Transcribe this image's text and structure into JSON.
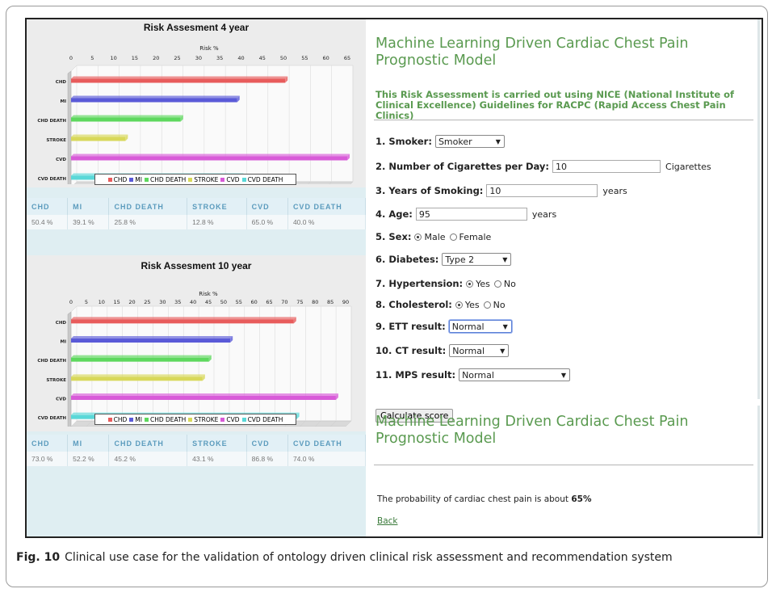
{
  "left_panel": {
    "charts": [
      {
        "title": "Risk Assesment 4 year",
        "axis_label": "Risk %",
        "ticks": [
          "0",
          "5",
          "10",
          "15",
          "20",
          "25",
          "30",
          "35",
          "40",
          "45",
          "50",
          "55",
          "60",
          "65"
        ],
        "axis_max": 65,
        "table_headers": [
          "CHD",
          "MI",
          "CHD DEATH",
          "STROKE",
          "CVD",
          "CVD DEATH"
        ],
        "table_values": [
          "50.4 %",
          "39.1 %",
          "25.8 %",
          "12.8 %",
          "65.0 %",
          "40.0 %"
        ]
      },
      {
        "title": "Risk Assesment 10 year",
        "axis_label": "Risk %",
        "ticks": [
          "0",
          "5",
          "10",
          "15",
          "20",
          "25",
          "30",
          "35",
          "40",
          "45",
          "50",
          "55",
          "60",
          "65",
          "70",
          "75",
          "80",
          "85",
          "90"
        ],
        "axis_max": 90,
        "table_headers": [
          "CHD",
          "MI",
          "CHD DEATH",
          "STROKE",
          "CVD",
          "CVD DEATH"
        ],
        "table_values": [
          "73.0 %",
          "52.2 %",
          "45.2 %",
          "43.1 %",
          "86.8 %",
          "74.0 %"
        ]
      }
    ]
  },
  "chart_data": [
    {
      "type": "bar",
      "title": "Risk Assesment 4 year",
      "xlabel": "Risk %",
      "ylabel": "",
      "categories": [
        "CHD",
        "MI",
        "CHD DEATH",
        "STROKE",
        "CVD",
        "CVD DEATH"
      ],
      "values": [
        50.4,
        39.1,
        25.8,
        12.8,
        65.0,
        40.0
      ],
      "xlim": [
        0,
        65
      ],
      "colors": [
        "#e85c5c",
        "#5a5ad8",
        "#5ed85e",
        "#d8d85a",
        "#d85ad8",
        "#5ad8d8"
      ],
      "legend": [
        "CHD",
        "MI",
        "CHD DEATH",
        "STROKE",
        "CVD",
        "CVD DEATH"
      ],
      "legend_position": "bottom",
      "grid": true
    },
    {
      "type": "bar",
      "title": "Risk Assesment 10 year",
      "xlabel": "Risk %",
      "ylabel": "",
      "categories": [
        "CHD",
        "MI",
        "CHD DEATH",
        "STROKE",
        "CVD",
        "CVD DEATH"
      ],
      "values": [
        73.0,
        52.2,
        45.2,
        43.1,
        86.8,
        74.0
      ],
      "xlim": [
        0,
        90
      ],
      "colors": [
        "#e85c5c",
        "#5a5ad8",
        "#5ed85e",
        "#d8d85a",
        "#d85ad8",
        "#5ad8d8"
      ],
      "legend": [
        "CHD",
        "MI",
        "CHD DEATH",
        "STROKE",
        "CVD",
        "CVD DEATH"
      ],
      "legend_position": "bottom",
      "grid": true
    }
  ],
  "form": {
    "title": "Machine Learning Driven Cardiac Chest Pain Prognostic Model",
    "subtitle": "This Risk Assessment is carried out using NICE (National Institute of Clinical Excellence) Guidelines for RACPC (Rapid Access Chest Pain Clinics)",
    "smoker_label": "1. Smoker:",
    "smoker_value": "Smoker",
    "cigs_label": "2. Number of Cigarettes per Day:",
    "cigs_value": "10",
    "cigs_unit": "Cigarettes",
    "years_label": "3. Years of Smoking:",
    "years_value": "10",
    "years_unit": "years",
    "age_label": "4. Age:",
    "age_value": "95",
    "age_unit": "years",
    "sex_label": "5. Sex:",
    "sex_male": "Male",
    "sex_female": "Female",
    "diabetes_label": "6. Diabetes:",
    "diabetes_value": "Type 2",
    "hyper_label": "7. Hypertension:",
    "yes": "Yes",
    "no": "No",
    "chol_label": "8. Cholesterol:",
    "ett_label": "9. ETT result:",
    "ett_value": "Normal",
    "ct_label": "10. CT result:",
    "ct_value": "Normal",
    "mps_label": "11. MPS result:",
    "mps_value": "Normal",
    "calc_button": "Calculate score"
  },
  "result": {
    "title": "Machine Learning Driven Cardiac Chest Pain Prognostic Model",
    "text": "The probability of cardiac chest pain is about ",
    "value": "65%",
    "back": "Back"
  },
  "caption": {
    "label": "Fig. 10",
    "text": "Clinical use case for the validation of ontology driven clinical risk assessment and recommendation system"
  }
}
